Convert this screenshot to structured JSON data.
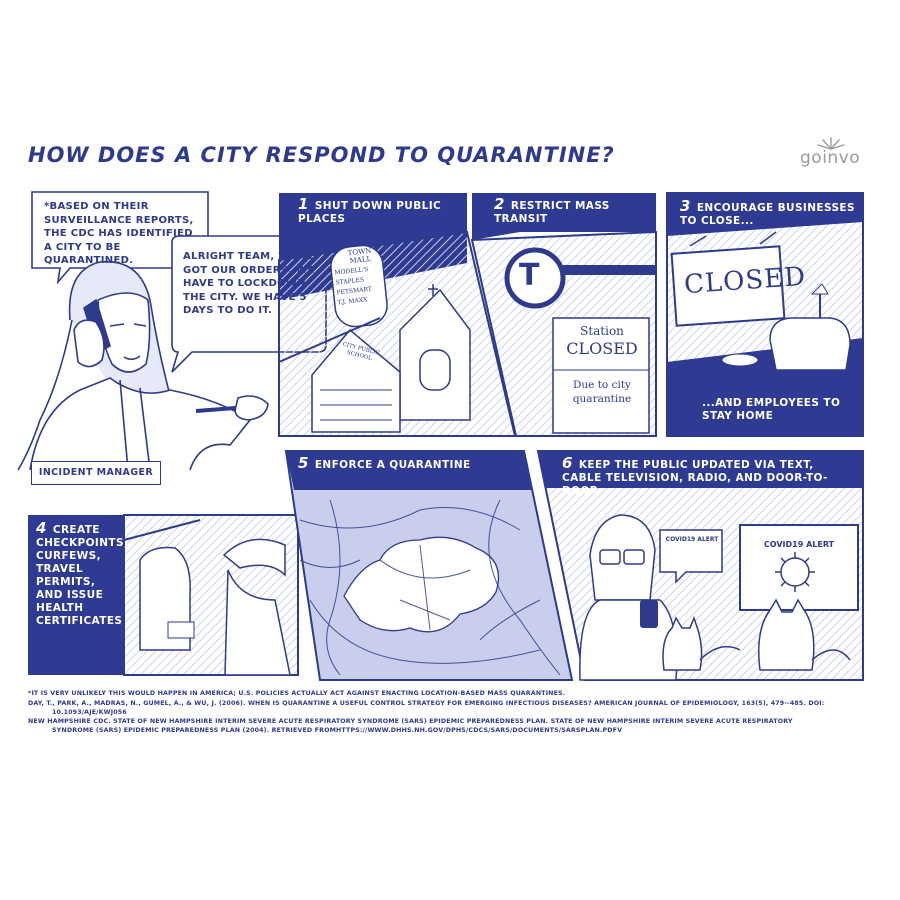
{
  "title": "HOW DOES A CITY RESPOND TO QUARANTINE?",
  "logo": "goinvo",
  "intro_bubble": "*BASED ON THEIR SURVEILLANCE REPORTS, THE CDC HAS IDENTIFIED A CITY TO BE QUARANTINED.",
  "manager_bubble": "ALRIGHT TEAM, WE'VE GOT OUR ORDERS. WE HAVE TO LOCKDOWN THE CITY. WE HAVE 5 DAYS TO DO IT.",
  "manager_label": "INCIDENT MANAGER",
  "panels": {
    "p1": {
      "num": "1",
      "text": "SHUT DOWN PUBLIC PLACES"
    },
    "p2": {
      "num": "2",
      "text": "RESTRICT MASS TRANSIT"
    },
    "p3": {
      "num": "3",
      "text": "ENCOURAGE BUSINESSES TO CLOSE...",
      "sub": "...AND EMPLOYEES TO STAY HOME"
    },
    "p4": {
      "num": "4",
      "text": "CREATE CHECKPOINTS, CURFEWS, TRAVEL PERMITS, AND ISSUE HEALTH CERTIFICATES"
    },
    "p5": {
      "num": "5",
      "text": "ENFORCE A QUARANTINE"
    },
    "p6": {
      "num": "6",
      "text": "KEEP THE PUBLIC UPDATED VIA TEXT, CABLE TELEVISION, RADIO, AND DOOR-TO-DOOR"
    }
  },
  "signs": {
    "town_mall": "TOWN MALL",
    "store1": "MODELL'S",
    "store2": "STAPLES",
    "store3": "PETSMART",
    "store4": "T.J. MAXX",
    "school": "CITY PUBLIC SCHOOL",
    "t_logo": "T",
    "station1": "Station",
    "station2": "CLOSED",
    "station3": "Due to city",
    "station4": "quarantine",
    "closed_sign": "CLOSED",
    "phone_alert": "COVID19 ALERT",
    "tv_alert": "COVID19 ALERT"
  },
  "footnotes": [
    "*IT IS VERY UNLIKELY THIS WOULD HAPPEN IN AMERICA; U.S. POLICIES ACTUALLY ACT AGAINST ENACTING LOCATION-BASED MASS QUARANTINES.",
    "DAY, T., PARK, A., MADRAS, N., GUMEL, A., & WU, J. (2006). WHEN IS QUARANTINE A USEFUL CONTROL STRATEGY FOR EMERGING INFECTIOUS DISEASES? AMERICAN JOURNAL OF EPIDEMIOLOGY, 163(5), 479--485. DOI:",
    "10.1093/AJE/KWJ056",
    "NEW HAMPSHIRE CDC. STATE OF NEW HAMPSHIRE INTERIM SEVERE ACUTE RESPIRATORY SYNDROME (SARS) EPIDEMIC PREPAREDNESS PLAN. STATE OF NEW HAMPSHIRE INTERIM SEVERE ACUTE RESPIRATORY",
    "SYNDROME (SARS) EPIDEMIC PREPAREDNESS PLAN (2004). RETRIEVED FROMHTTPS://WWW.DHHS.NH.GOV/DPHS/CDCS/SARS/DOCUMENTS/SARSPLAN.PDFV"
  ],
  "colors": {
    "ink": "#2e3a8c",
    "panel_fill": "#2f3a92",
    "tint": "#cdd2ee"
  }
}
